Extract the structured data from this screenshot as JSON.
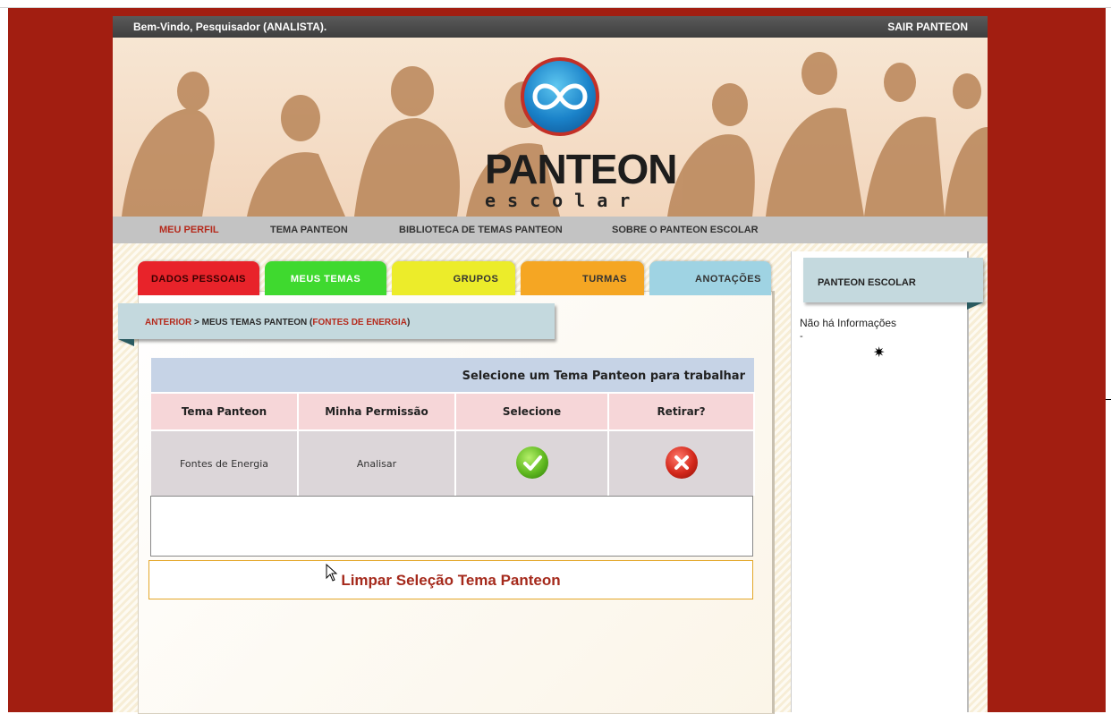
{
  "topbar": {
    "welcome": "Bem-Vindo, Pesquisador (ANALISTA).",
    "logout": "SAIR PANTEON"
  },
  "logo": {
    "title": "PANTEON",
    "subtitle": "escolar",
    "ring_color": "#c33027",
    "circle_color": "#1a82c9"
  },
  "nav": {
    "items": [
      {
        "label": "MEU PERFIL",
        "active": true
      },
      {
        "label": "TEMA PANTEON",
        "active": false
      },
      {
        "label": "BIBLIOTECA DE TEMAS PANTEON",
        "active": false
      },
      {
        "label": "SOBRE O PANTEON ESCOLAR",
        "active": false
      }
    ]
  },
  "tabs": [
    {
      "label": "DADOS PESSOAIS",
      "color": "#e8232a"
    },
    {
      "label": "MEUS TEMAS",
      "color": "#3fd92f"
    },
    {
      "label": "GRUPOS",
      "color": "#ecec2a"
    },
    {
      "label": "TURMAS",
      "color": "#f5a623"
    },
    {
      "label": "ANOTAÇÕES",
      "color": "#9fd3e3"
    }
  ],
  "breadcrumb": {
    "back": "ANTERIOR",
    "sep": " > ",
    "section": "MEUS TEMAS PANTEON (",
    "current": "FONTES DE ENERGIA",
    "close": ")"
  },
  "table": {
    "caption": "Selecione um Tema Panteon para trabalhar",
    "headers": [
      "Tema Panteon",
      "Minha Permissão",
      "Selecione",
      "Retirar?"
    ],
    "rows": [
      {
        "tema": "Fontes de Energia",
        "permissao": "Analisar",
        "select_icon": "check-icon",
        "remove_icon": "x-icon"
      }
    ]
  },
  "clear_button": "Limpar Seleção Tema Panteon",
  "side": {
    "title": "PANTEON ESCOLAR",
    "info": "Não há Informações",
    "dash": "-",
    "star": "✷"
  },
  "colors": {
    "frame": "#a21e11",
    "accent_red": "#b52a1c",
    "header_blue": "#c4d9de"
  }
}
